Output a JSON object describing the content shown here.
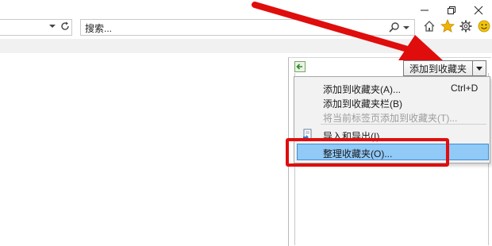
{
  "window": {
    "minimize_icon": "minimize-icon",
    "restore_icon": "restore-icon",
    "close_icon": "close-icon"
  },
  "address_bar": {
    "dropdown_icon": "chevron-down-icon",
    "refresh_icon": "refresh-icon"
  },
  "search": {
    "placeholder": "搜索...",
    "search_icon": "search-icon",
    "dropdown_icon": "chevron-down-icon"
  },
  "toolbar": {
    "home_icon": "home-icon",
    "favorites_icon": "star-icon",
    "settings_icon": "gear-icon",
    "feedback_icon": "smiley-icon",
    "favorites_color": "#f0b400",
    "feedback_color": "#f5c400"
  },
  "favorites_panel": {
    "back_icon": "pin-back-icon",
    "add_button_label": "添加到收藏夹",
    "add_dropdown_icon": "triangle-down-icon"
  },
  "menu": {
    "items": [
      {
        "label": "添加到收藏夹(A)...",
        "shortcut": "Ctrl+D",
        "enabled": true
      },
      {
        "label": "添加到收藏夹栏(B)",
        "shortcut": "",
        "enabled": true
      },
      {
        "label": "将当前标签页添加到收藏夹(T)...",
        "shortcut": "",
        "enabled": false
      },
      {
        "label": "导入和导出(I)...",
        "shortcut": "",
        "enabled": true,
        "icon": "import-export-icon"
      },
      {
        "label": "整理收藏夹(O)...",
        "shortcut": "",
        "enabled": true,
        "highlighted": true
      }
    ]
  },
  "annotation": {
    "color": "#e00d0d"
  }
}
